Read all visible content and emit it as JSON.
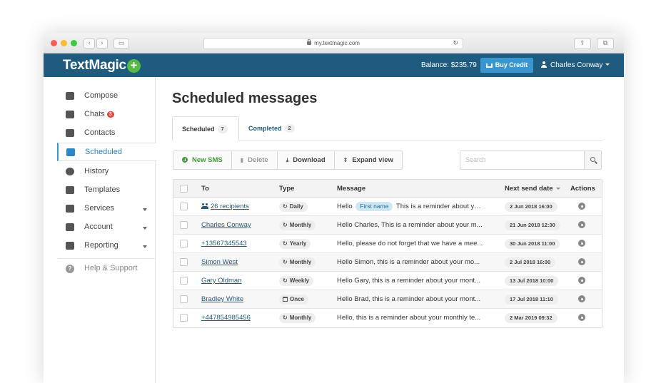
{
  "browser": {
    "url": "my.textmagic.com"
  },
  "header": {
    "logo": "TextMagic",
    "balance": "Balance: $235.79",
    "buy_credit": "Buy Credit",
    "user_name": "Charles Conway"
  },
  "sidebar": {
    "items": [
      {
        "label": "Compose",
        "icon": "compose-icon"
      },
      {
        "label": "Chats",
        "icon": "chat-icon",
        "badge": "3"
      },
      {
        "label": "Contacts",
        "icon": "contacts-icon"
      },
      {
        "label": "Scheduled",
        "icon": "calendar-icon",
        "active": true
      },
      {
        "label": "History",
        "icon": "history-icon"
      },
      {
        "label": "Templates",
        "icon": "templates-icon"
      },
      {
        "label": "Services",
        "icon": "services-icon",
        "expandable": true
      },
      {
        "label": "Account",
        "icon": "account-icon",
        "expandable": true
      },
      {
        "label": "Reporting",
        "icon": "reporting-icon",
        "expandable": true
      }
    ],
    "help": "Help & Support"
  },
  "main": {
    "title": "Scheduled messages",
    "tabs": [
      {
        "label": "Scheduled",
        "count": "7"
      },
      {
        "label": "Completed",
        "count": "2"
      }
    ],
    "toolbar": {
      "new_sms": "New SMS",
      "delete": "Delete",
      "download": "Download",
      "expand": "Expand view"
    },
    "search_placeholder": "Search"
  },
  "table": {
    "columns": {
      "to": "To",
      "type": "Type",
      "message": "Message",
      "next_send": "Next send date",
      "actions": "Actions"
    },
    "rows": [
      {
        "to": "26 recipients",
        "type": "Daily",
        "msg_prefix": "Hello",
        "token": "First name",
        "msg": "This is a reminder about yo...",
        "date": "2 Jun 2018 16:00"
      },
      {
        "to": "Charles Conway",
        "type": "Monthly",
        "msg_prefix": "",
        "token": "",
        "msg": "Hello Charles, This is a reminder about your m...",
        "date": "21 Jun 2018 12:30"
      },
      {
        "to": "+13567345543",
        "type": "Yearly",
        "msg_prefix": "",
        "token": "",
        "msg": "Hello, please do not forget that we have a mee...",
        "date": "30 Jun 2018 11:00"
      },
      {
        "to": "Simon West",
        "type": "Monthly",
        "msg_prefix": "",
        "token": "",
        "msg": "Hello Simon, this is a reminder about your mo...",
        "date": "2 Jul 2018 16:00"
      },
      {
        "to": "Gary Oldman",
        "type": "Weekly",
        "msg_prefix": "",
        "token": "",
        "msg": "Hello Gary, this is a reminder about your mont...",
        "date": "13 Jul 2018 10:00"
      },
      {
        "to": "Bradley White",
        "type": "Once",
        "msg_prefix": "",
        "token": "",
        "msg": "Hello Brad, this is a reminder about your mont...",
        "date": "17 Jul 2018 11:10"
      },
      {
        "to": "+447854985456",
        "type": "Monthly",
        "msg_prefix": "",
        "token": "",
        "msg": "Hello, this is a reminder about your monthly te...",
        "date": "2 Mar 2019 09:32"
      }
    ]
  }
}
